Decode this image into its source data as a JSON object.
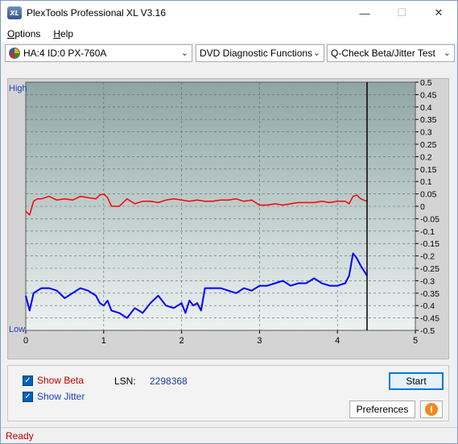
{
  "window": {
    "title": "PlexTools Professional XL V3.16",
    "icon_text": "XL",
    "minimize_glyph": "—",
    "maximize_glyph": "☐",
    "close_glyph": "✕"
  },
  "menu": [
    {
      "label": "Options",
      "mnemonic": "O",
      "rest": "ptions"
    },
    {
      "label": "Help",
      "mnemonic": "H",
      "rest": "elp"
    }
  ],
  "toolbar": {
    "drive": "HA:4 ID:0  PX-760A",
    "function": "DVD Diagnostic Functions",
    "test": "Q-Check Beta/Jitter Test",
    "dropdown_glyph": "⌄"
  },
  "chart_data": {
    "type": "line",
    "left_axis_labels": {
      "top": "High",
      "bottom": "Low"
    },
    "x_ticks": [
      0,
      1,
      2,
      3,
      4,
      5
    ],
    "xlim": [
      0,
      5
    ],
    "y_right_ticks": [
      0.5,
      0.45,
      0.4,
      0.35,
      0.3,
      0.25,
      0.2,
      0.15,
      0.1,
      0.05,
      0,
      -0.05,
      -0.1,
      -0.15,
      -0.2,
      -0.25,
      -0.3,
      -0.35,
      -0.4,
      -0.45,
      -0.5
    ],
    "ylim": [
      -0.5,
      0.5
    ],
    "grid": true,
    "position_marker_x": 4.38,
    "series": [
      {
        "color": "#ff0000",
        "x": [
          0,
          0.05,
          0.1,
          0.15,
          0.2,
          0.3,
          0.4,
          0.5,
          0.6,
          0.7,
          0.8,
          0.9,
          0.95,
          1.0,
          1.05,
          1.1,
          1.2,
          1.3,
          1.4,
          1.5,
          1.6,
          1.7,
          1.8,
          1.9,
          2.0,
          2.1,
          2.2,
          2.3,
          2.4,
          2.5,
          2.6,
          2.7,
          2.8,
          2.9,
          3.0,
          3.1,
          3.2,
          3.3,
          3.4,
          3.5,
          3.6,
          3.7,
          3.8,
          3.9,
          4.0,
          4.1,
          4.15,
          4.2,
          4.25,
          4.3,
          4.38
        ],
        "values": [
          -0.02,
          -0.035,
          0.02,
          0.03,
          0.03,
          0.04,
          0.025,
          0.03,
          0.025,
          0.04,
          0.035,
          0.03,
          0.045,
          0.05,
          0.035,
          0.0,
          0.0,
          0.03,
          0.01,
          0.02,
          0.02,
          0.015,
          0.025,
          0.03,
          0.025,
          0.02,
          0.025,
          0.02,
          0.02,
          0.025,
          0.025,
          0.03,
          0.02,
          0.025,
          0.005,
          0.005,
          0.01,
          0.005,
          0.01,
          0.015,
          0.015,
          0.015,
          0.02,
          0.015,
          0.02,
          0.02,
          0.01,
          0.04,
          0.045,
          0.03,
          0.02
        ]
      },
      {
        "color": "#0000ff",
        "x": [
          0,
          0.05,
          0.1,
          0.15,
          0.2,
          0.3,
          0.4,
          0.5,
          0.6,
          0.7,
          0.8,
          0.9,
          0.95,
          1.0,
          1.05,
          1.1,
          1.2,
          1.3,
          1.4,
          1.5,
          1.6,
          1.7,
          1.8,
          1.9,
          2.0,
          2.05,
          2.1,
          2.15,
          2.2,
          2.25,
          2.3,
          2.4,
          2.5,
          2.6,
          2.7,
          2.8,
          2.9,
          3.0,
          3.1,
          3.2,
          3.3,
          3.4,
          3.5,
          3.6,
          3.7,
          3.8,
          3.9,
          4.0,
          4.1,
          4.15,
          4.2,
          4.25,
          4.3,
          4.38
        ],
        "values": [
          -0.36,
          -0.42,
          -0.35,
          -0.34,
          -0.33,
          -0.33,
          -0.34,
          -0.37,
          -0.35,
          -0.33,
          -0.34,
          -0.36,
          -0.39,
          -0.4,
          -0.38,
          -0.42,
          -0.43,
          -0.45,
          -0.41,
          -0.43,
          -0.39,
          -0.36,
          -0.4,
          -0.41,
          -0.39,
          -0.43,
          -0.38,
          -0.4,
          -0.39,
          -0.42,
          -0.33,
          -0.33,
          -0.33,
          -0.34,
          -0.35,
          -0.33,
          -0.34,
          -0.32,
          -0.32,
          -0.31,
          -0.3,
          -0.32,
          -0.31,
          -0.31,
          -0.29,
          -0.31,
          -0.32,
          -0.32,
          -0.31,
          -0.28,
          -0.19,
          -0.21,
          -0.24,
          -0.28
        ]
      }
    ]
  },
  "controls": {
    "show_beta": "Show Beta",
    "show_beta_mnemonic": "B",
    "show_jitter": "Show Jitter",
    "show_jitter_mnemonic": "J",
    "checkbox_mark": "✓",
    "lsn_label": "LSN:",
    "lsn_value": "2298368",
    "start_label": "Start",
    "preferences_label": "Preferences",
    "info_glyph": "i"
  },
  "colors": {
    "beta": "#ff0000",
    "jitter": "#0000ff",
    "accent": "#0078d7",
    "status": "#c00000"
  },
  "status": {
    "text": "Ready"
  }
}
